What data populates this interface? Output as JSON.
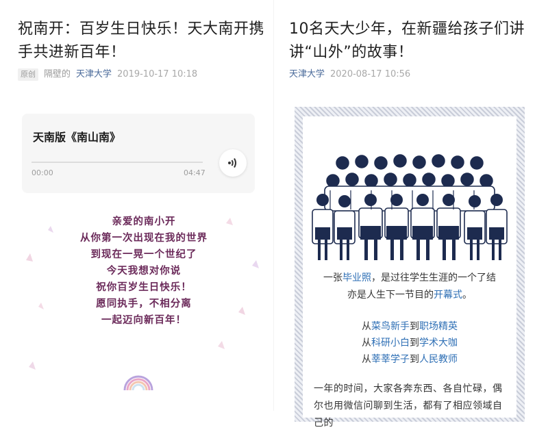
{
  "left_article": {
    "title": "祝南开：百岁生日快乐！天大南开携手共进新百年！",
    "original_tag": "原创",
    "author": "隔壁的",
    "account": "天津大学",
    "time": "2019-10-17 10:18",
    "audio": {
      "title": "天南版《南山南》",
      "current_time": "00:00",
      "duration": "04:47",
      "progress": 0
    },
    "poem": [
      "亲爱的南小开",
      "从你第一次出现在我的世界",
      "到现在一晃一个世纪了",
      "今天我想对你说",
      "祝你百岁生日快乐！",
      "愿同执手，不相分离",
      "一起迈向新百年！"
    ]
  },
  "right_article": {
    "title": "10名天大少年，在新疆给孩子们讲讲“山外”的故事！",
    "account": "天津大学",
    "time": "2020-08-17 10:56",
    "caption": {
      "l1_a": "一张",
      "l1_b": "毕业照",
      "l1_c": "，是过往学生生涯的一个了结",
      "l2_a": "亦是人生下一节目的",
      "l2_b": "开幕式",
      "l2_c": "。"
    },
    "ladder": [
      {
        "a": "从",
        "b": "菜鸟新手",
        "c": "到",
        "d": "职场精英"
      },
      {
        "a": "从",
        "b": "科研小白",
        "c": "到",
        "d": "学术大咖"
      },
      {
        "a": "从",
        "b": "莘莘学子",
        "c": "到",
        "d": "人民教师"
      }
    ],
    "body": "一年的时间，大家各奔东西、各自忙碌，偶尔也用微信问聊到生活，都有了相应领域自己的"
  },
  "colors": {
    "poem": "#6b2a5a",
    "account": "#4a6a9a",
    "highlight": "#2e6fb5",
    "illustration": "#1d2b4f"
  }
}
